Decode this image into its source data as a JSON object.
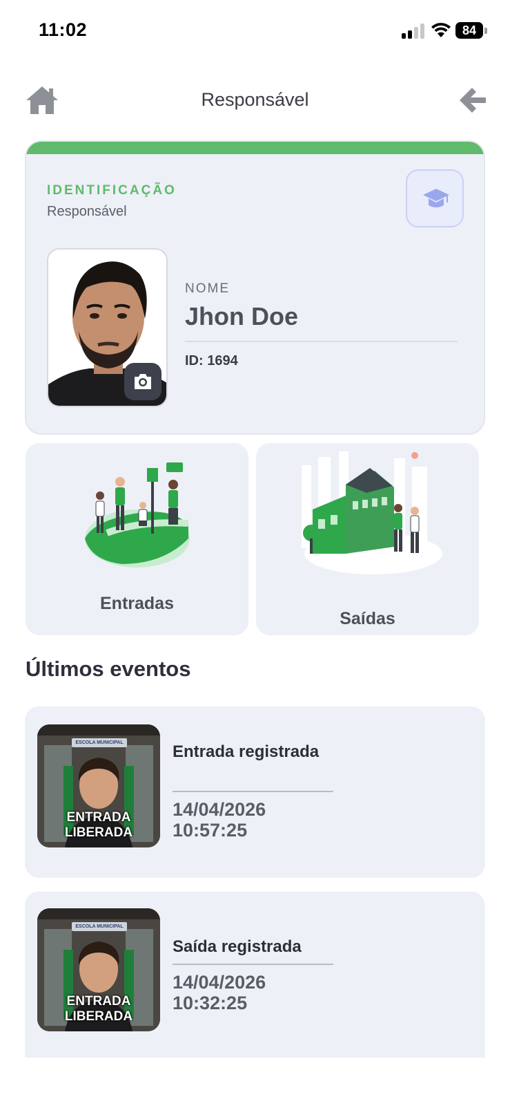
{
  "status_bar": {
    "time": "11:02",
    "battery": "84",
    "icons": [
      "signal-icon",
      "wifi-icon",
      "battery-icon"
    ]
  },
  "nav": {
    "title": "Responsável",
    "home_icon": "home-icon",
    "back_icon": "arrow-left-icon"
  },
  "id_card": {
    "eyebrow": "IDENTIFICAÇÃO",
    "subtitle": "Responsável",
    "name_label": "NOME",
    "name": "Jhon Doe",
    "id_text": "ID: 1694",
    "accent_color": "#5fba6b",
    "icons": [
      "graduation-cap-icon",
      "camera-icon"
    ]
  },
  "actions": {
    "entries_label": "Entradas",
    "exits_label": "Saídas"
  },
  "events": {
    "section_title": "Últimos eventos",
    "items": [
      {
        "thumb_sign": "ESCOLA MUNICIPAL",
        "thumb_line1": "ENTRADA",
        "thumb_line2": "LIBERADA",
        "title": "Entrada registrada",
        "date": "14/04/2026",
        "time": "10:57:25"
      },
      {
        "thumb_sign": "ESCOLA MUNICIPAL",
        "thumb_line1": "ENTRADA",
        "thumb_line2": "LIBERADA",
        "title": "Saída registrada",
        "date": "14/04/2026",
        "time": "10:32:25"
      }
    ]
  }
}
